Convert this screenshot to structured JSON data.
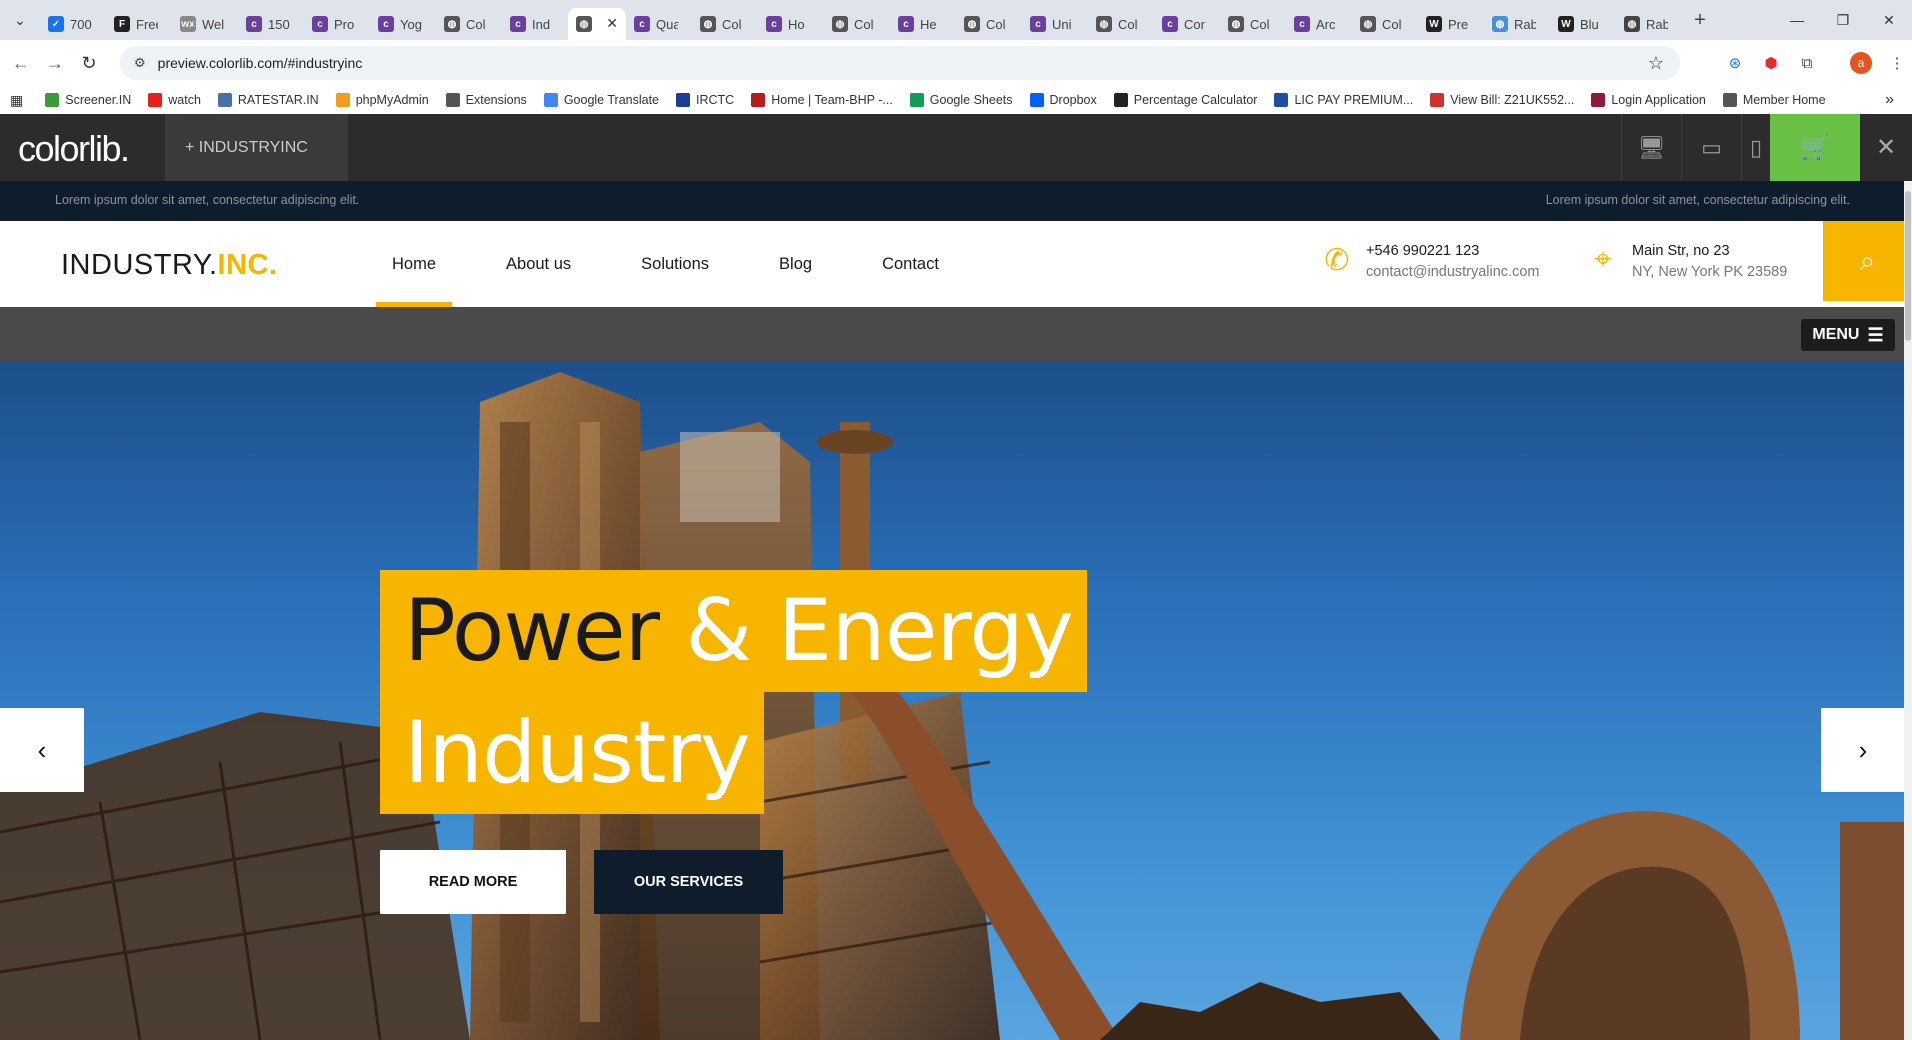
{
  "browser": {
    "tabs": [
      {
        "title": "700",
        "color": "#1a73e8",
        "glyph": "✓"
      },
      {
        "title": "Free",
        "color": "#222222",
        "glyph": "F"
      },
      {
        "title": "Wel",
        "color": "#888888",
        "glyph": "wx"
      },
      {
        "title": "150",
        "color": "#6b3fa0",
        "glyph": "c"
      },
      {
        "title": "Pro",
        "color": "#6b3fa0",
        "glyph": "c"
      },
      {
        "title": "Yog",
        "color": "#6b3fa0",
        "glyph": "c"
      },
      {
        "title": "Col",
        "color": "#555555",
        "glyph": "◍"
      },
      {
        "title": "Ind",
        "color": "#6b3fa0",
        "glyph": "c"
      },
      {
        "title": "Qua",
        "color": "#6b3fa0",
        "glyph": "c"
      },
      {
        "title": "Col",
        "color": "#555555",
        "glyph": "◍"
      },
      {
        "title": "Ho",
        "color": "#6b3fa0",
        "glyph": "c"
      },
      {
        "title": "Col",
        "color": "#555555",
        "glyph": "◍"
      },
      {
        "title": "He",
        "color": "#6b3fa0",
        "glyph": "c"
      },
      {
        "title": "Col",
        "color": "#555555",
        "glyph": "◍"
      },
      {
        "title": "Uni",
        "color": "#6b3fa0",
        "glyph": "c"
      },
      {
        "title": "Col",
        "color": "#555555",
        "glyph": "◍"
      },
      {
        "title": "Cor",
        "color": "#6b3fa0",
        "glyph": "c"
      },
      {
        "title": "Col",
        "color": "#555555",
        "glyph": "◍"
      },
      {
        "title": "Arc",
        "color": "#6b3fa0",
        "glyph": "c"
      },
      {
        "title": "Col",
        "color": "#555555",
        "glyph": "◍"
      },
      {
        "title": "Pre",
        "color": "#222222",
        "glyph": "W"
      },
      {
        "title": "Rab",
        "color": "#4a90d9",
        "glyph": "◍"
      },
      {
        "title": "Blu",
        "color": "#222222",
        "glyph": "W"
      },
      {
        "title": "Rab",
        "color": "#444444",
        "glyph": "◍"
      }
    ],
    "active_tab_index": 7,
    "url": "preview.colorlib.com/#industryinc",
    "avatar_letter": "a",
    "bookmarks": [
      {
        "label": "Screener.IN",
        "color": "#3c9a3c"
      },
      {
        "label": "watch",
        "color": "#e62117"
      },
      {
        "label": "RATESTAR.IN",
        "color": "#4a6fa5"
      },
      {
        "label": "phpMyAdmin",
        "color": "#f29b1d"
      },
      {
        "label": "Extensions",
        "color": "#555555"
      },
      {
        "label": "Google Translate",
        "color": "#4285f4"
      },
      {
        "label": "IRCTC",
        "color": "#1c3f94"
      },
      {
        "label": "Home | Team-BHP -...",
        "color": "#b71c1c"
      },
      {
        "label": "Google Sheets",
        "color": "#0f9d58"
      },
      {
        "label": "Dropbox",
        "color": "#0061fe"
      },
      {
        "label": "Percentage Calculator",
        "color": "#222222"
      },
      {
        "label": "LIC PAY PREMIUM...",
        "color": "#1f4e9c"
      },
      {
        "label": "View Bill: Z21UK552...",
        "color": "#d32f2f"
      },
      {
        "label": "Login Application",
        "color": "#8e1b3e"
      },
      {
        "label": "Member Home",
        "color": "#555555"
      }
    ]
  },
  "preview_bar": {
    "logo": "colorlib.",
    "theme_name": "+ INDUSTRYINC"
  },
  "site": {
    "topbar_left": "Lorem ipsum dolor sit amet, consectetur adipiscing elit.",
    "topbar_right": "Lorem ipsum dolor sit amet, consectetur adipiscing elit.",
    "brand_main": "INDUSTRY.",
    "brand_accent": "INC.",
    "nav": [
      "Home",
      "About us",
      "Solutions",
      "Blog",
      "Contact"
    ],
    "active_nav": "Home",
    "phone": "+546 990221 123",
    "email": "contact@industryalinc.com",
    "address_line1": "Main Str, no 23",
    "address_line2": "NY, New York PK 23589",
    "menu_label": "MENU",
    "hero_line1_dark": "Power",
    "hero_line1_light": " & Energy",
    "hero_line2": "Industry",
    "btn_read_more": "READ MORE",
    "btn_services": "OUR SERVICES",
    "accent_color": "#f7b500",
    "dark_color": "#0e1c2b"
  }
}
